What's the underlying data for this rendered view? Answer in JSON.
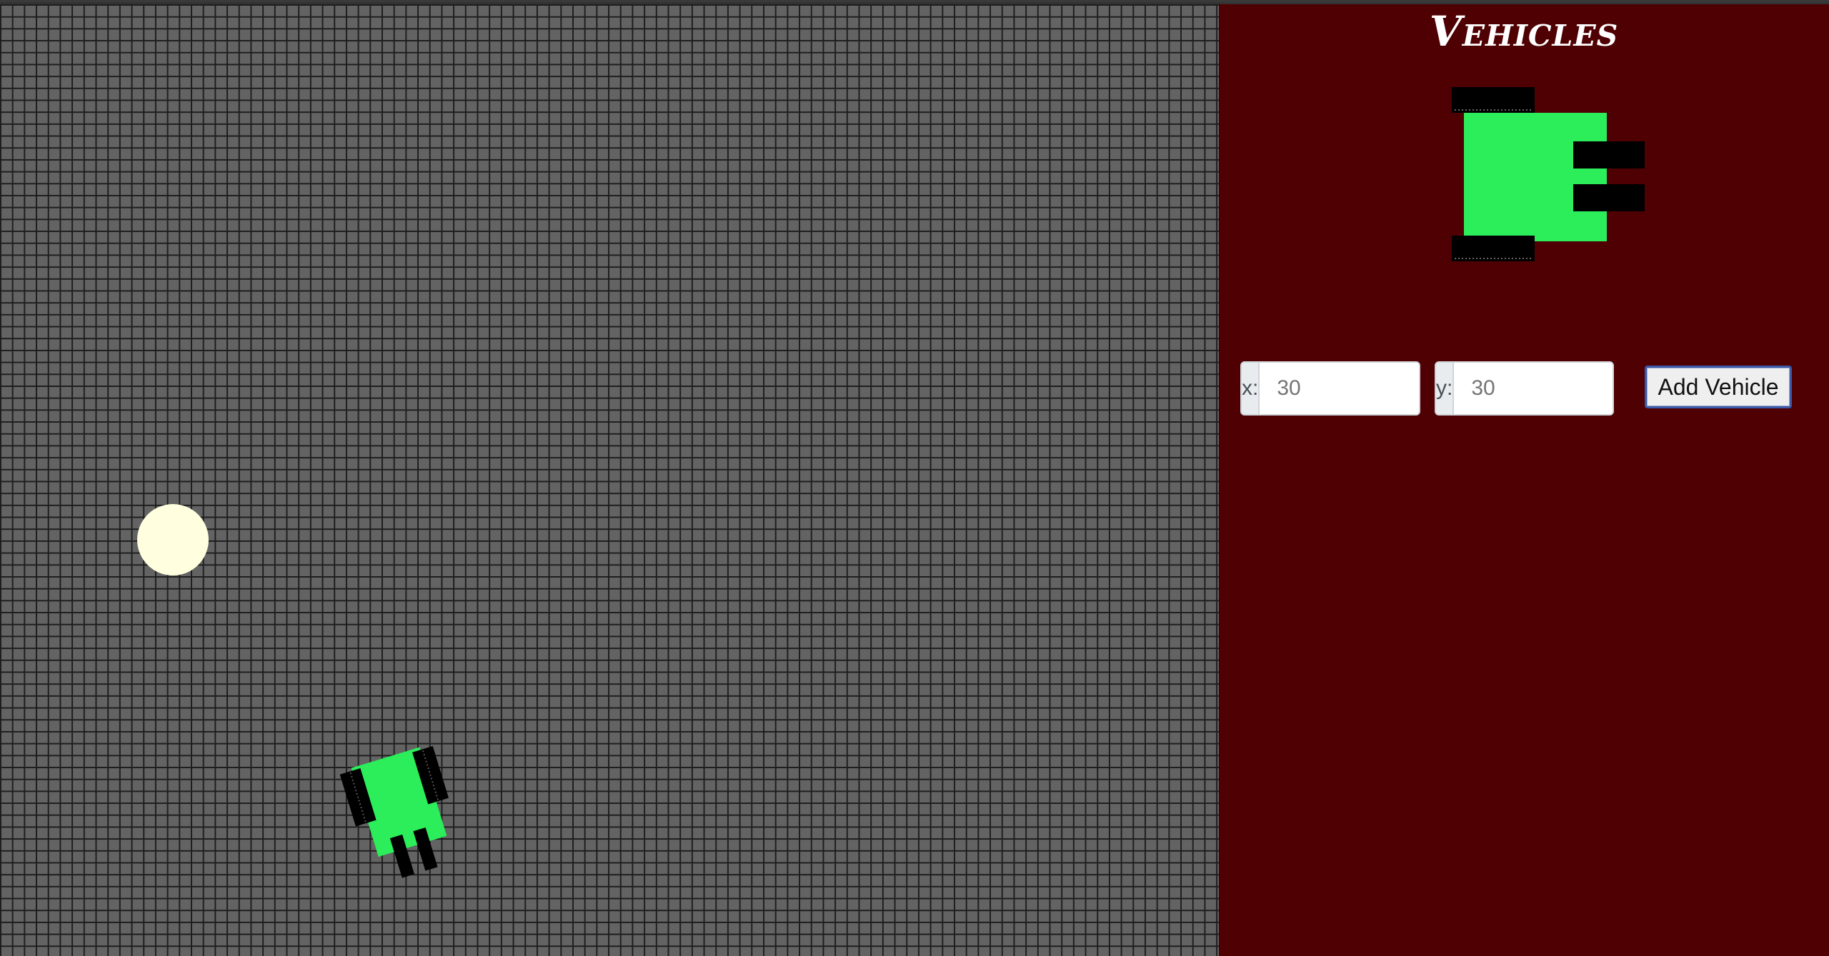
{
  "title": "Vehicles",
  "colors": {
    "world_background": "#636363",
    "grid_lines": "#1e1e1e",
    "panel_background": "#4f0003",
    "vehicle_body": "#2bee5a",
    "vehicle_parts": "#000000",
    "light_source": "#ffffe0"
  },
  "form": {
    "x_label": "x:",
    "x_value": "30",
    "y_label": "y:",
    "y_value": "30",
    "add_button_label": "Add Vehicle"
  }
}
